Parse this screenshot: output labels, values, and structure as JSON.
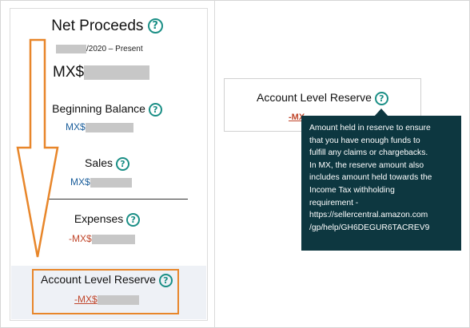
{
  "net_proceeds": {
    "title": "Net Proceeds",
    "period": "/2020 – Present",
    "amount_prefix": "MX$"
  },
  "rows": {
    "beginning_balance": {
      "label": "Beginning Balance",
      "amount_prefix": "MX$"
    },
    "sales": {
      "label": "Sales",
      "amount_prefix": "MX$"
    },
    "expenses": {
      "label": "Expenses",
      "amount_prefix": "-MX$"
    },
    "account_level_reserve": {
      "label": "Account Level Reserve",
      "amount_prefix": "-MX$"
    }
  },
  "detail_card": {
    "title": "Account Level Reserve",
    "amount_prefix": "-MX"
  },
  "tooltip": {
    "lines": [
      "Amount held in reserve to ensure",
      "that you have enough funds to",
      "fulfill any claims or chargebacks.",
      "In MX, the reserve amount also",
      "includes amount held towards the",
      "Income Tax withholding",
      "requirement -",
      "https://sellercentral.amazon.com",
      "/gp/help/GH6DEGUR6TACREV9"
    ]
  },
  "help_glyph": "?",
  "icons": {
    "help": "help-circle-icon",
    "annotation": "down-arrow-annotation"
  },
  "colors": {
    "teal": "#1b8f86",
    "positive_amount": "#1b5e9b",
    "negative_amount": "#c0462b",
    "highlight": "#e8862a",
    "tooltip_bg": "#0d3740"
  }
}
